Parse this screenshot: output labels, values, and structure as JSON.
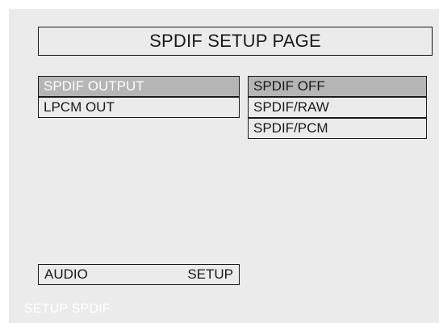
{
  "page": {
    "title": "SPDIF SETUP PAGE"
  },
  "left_menu": {
    "items": [
      {
        "label": "SPDIF OUTPUT",
        "active": true
      },
      {
        "label": "LPCM OUT",
        "active": false
      }
    ]
  },
  "right_menu": {
    "items": [
      {
        "label": "SPDIF OFF",
        "active": true
      },
      {
        "label": "SPDIF/RAW",
        "active": false
      },
      {
        "label": "SPDIF/PCM",
        "active": false
      }
    ]
  },
  "footer_nav": {
    "left_label": "AUDIO",
    "right_label": "SETUP"
  },
  "status": {
    "text": "SETUP SPDIF"
  },
  "colors": {
    "screen_bg": "#ebebeb",
    "highlight": "#b5b5b5",
    "border": "#1a1a1a",
    "highlight_text_left": "#ffffff"
  }
}
